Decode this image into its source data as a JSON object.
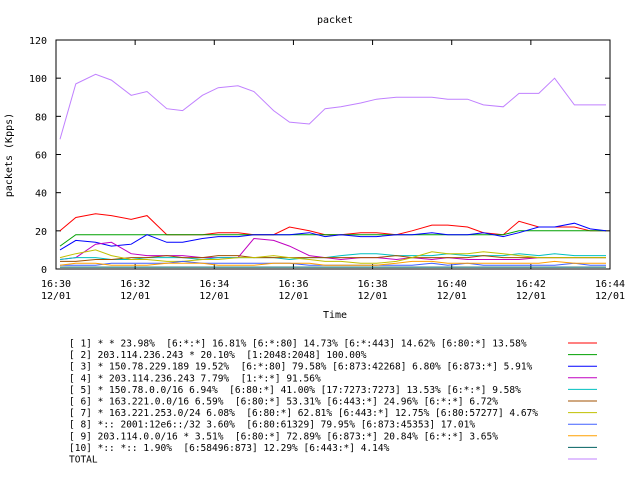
{
  "chart_data": {
    "type": "line",
    "title": "packet",
    "xlabel": "Time",
    "ylabel": "packets (Kpps)",
    "ylim": [
      0,
      120
    ],
    "xlim": [
      0,
      14
    ],
    "y_ticks": [
      0,
      20,
      40,
      60,
      80,
      100,
      120
    ],
    "x_ticks": [
      {
        "t": 0,
        "time": "16:30",
        "date": "12/01"
      },
      {
        "t": 2,
        "time": "16:32",
        "date": "12/01"
      },
      {
        "t": 4,
        "time": "16:34",
        "date": "12/01"
      },
      {
        "t": 6,
        "time": "16:36",
        "date": "12/01"
      },
      {
        "t": 8,
        "time": "16:38",
        "date": "12/01"
      },
      {
        "t": 10,
        "time": "16:40",
        "date": "12/01"
      },
      {
        "t": 12,
        "time": "16:42",
        "date": "12/01"
      },
      {
        "t": 14,
        "time": "16:44",
        "date": "12/01"
      }
    ],
    "grid": false,
    "legend_position": "bottom",
    "x": [
      0.1,
      0.5,
      1.0,
      1.4,
      1.9,
      2.3,
      2.8,
      3.2,
      3.7,
      4.1,
      4.6,
      5.0,
      5.5,
      5.9,
      6.4,
      6.8,
      7.2,
      7.7,
      8.1,
      8.6,
      9.0,
      9.5,
      9.9,
      10.4,
      10.8,
      11.3,
      11.7,
      12.2,
      12.6,
      13.1,
      13.5,
      13.9
    ],
    "series": [
      {
        "name": "[ 1] * * 23.98%  [6:*:*] 16.81% [6:*:80] 14.73% [6:*:443] 14.62% [6:80:*] 13.58%",
        "color": "#ff0000",
        "values": [
          20,
          27,
          29,
          28,
          26,
          28,
          18,
          18,
          18,
          19,
          19,
          18,
          18,
          22,
          20,
          18,
          18,
          19,
          19,
          18,
          20,
          23,
          23,
          22,
          19,
          18,
          25,
          22,
          22,
          22,
          20,
          20
        ]
      },
      {
        "name": "[ 2] 203.114.236.243 * 20.10%  [1:2048:2048] 100.00%",
        "color": "#00a000",
        "values": [
          12,
          18,
          18,
          18,
          18,
          18,
          18,
          18,
          18,
          18,
          18,
          18,
          18,
          18,
          18,
          18,
          18,
          18,
          18,
          18,
          18,
          18,
          18,
          18,
          18,
          18,
          20,
          20,
          20,
          20,
          20,
          20
        ]
      },
      {
        "name": "[ 3] * 150.78.229.189 19.52%  [6:*:80] 79.58% [6:873:42268] 6.80% [6:873:*] 5.91%",
        "color": "#0000ff",
        "values": [
          10,
          15,
          14,
          12,
          13,
          18,
          14,
          14,
          16,
          17,
          17,
          18,
          18,
          18,
          19,
          17,
          18,
          17,
          17,
          18,
          18,
          19,
          18,
          18,
          19,
          17,
          19,
          22,
          22,
          24,
          21,
          20
        ]
      },
      {
        "name": "[ 4] * 203.114.236.243 7.79%  [1:*:*] 91.56%",
        "color": "#c000c0",
        "values": [
          5,
          6,
          13,
          14,
          8,
          7,
          7,
          7,
          6,
          6,
          6,
          16,
          15,
          12,
          7,
          6,
          5,
          6,
          6,
          5,
          6,
          5,
          6,
          5,
          5,
          5,
          5,
          6,
          6,
          6,
          6,
          6
        ]
      },
      {
        "name": "[ 5] * 150.78.0.0/16 6.94%  [6:80:*] 41.00% [17:7273:7273] 13.53% [6:*:*] 9.58%",
        "color": "#00c0c0",
        "values": [
          5,
          6,
          6,
          5,
          5,
          6,
          6,
          6,
          5,
          6,
          6,
          6,
          6,
          5,
          6,
          6,
          7,
          8,
          8,
          7,
          7,
          7,
          8,
          7,
          7,
          7,
          8,
          7,
          8,
          7,
          7,
          7
        ]
      },
      {
        "name": "[ 6] * 163.221.0.0/16 6.59%  [6:80:*] 53.31% [6:443:*] 24.96% [6:*:*] 6.72%",
        "color": "#a05000",
        "values": [
          4,
          4,
          5,
          5,
          6,
          6,
          7,
          6,
          6,
          7,
          7,
          6,
          6,
          6,
          6,
          6,
          6,
          6,
          6,
          7,
          6,
          6,
          6,
          6,
          7,
          6,
          6,
          6,
          6,
          6,
          6,
          6
        ]
      },
      {
        "name": "[ 7] * 163.221.253.0/24 6.08%  [6:80:*] 62.81% [6:443:*] 12.75% [6:80:57277] 4.67%",
        "color": "#c0c000",
        "values": [
          6,
          8,
          10,
          7,
          5,
          5,
          4,
          4,
          5,
          5,
          6,
          6,
          7,
          6,
          5,
          4,
          4,
          3,
          3,
          4,
          6,
          9,
          8,
          8,
          9,
          8,
          7,
          6,
          6,
          6,
          6,
          6
        ]
      },
      {
        "name": "[ 8] *:: 2001:12e6::/32 3.60%  [6:80:61329] 79.95% [6:873:45353] 17.01%",
        "color": "#4060ff",
        "values": [
          2,
          2,
          2,
          3,
          3,
          3,
          3,
          4,
          3,
          3,
          3,
          3,
          3,
          3,
          2,
          2,
          2,
          2,
          2,
          2,
          2,
          3,
          2,
          3,
          2,
          2,
          2,
          2,
          2,
          3,
          2,
          2
        ]
      },
      {
        "name": "[ 9] 203.114.0.0/16 * 3.51%  [6:80:*] 72.89% [6:873:*] 20.84% [6:*:*] 3.65%",
        "color": "#ffa000",
        "values": [
          2,
          3,
          3,
          2,
          2,
          2,
          3,
          3,
          3,
          2,
          2,
          2,
          3,
          3,
          3,
          2,
          2,
          2,
          2,
          3,
          4,
          4,
          3,
          3,
          3,
          3,
          3,
          3,
          4,
          3,
          3,
          3
        ]
      },
      {
        "name": "[10] *:: *:: 1.90%  [6:58496:873] 12.29% [6:443:*] 4.14%",
        "color": "#006060",
        "values": [
          1,
          1,
          1,
          1,
          1,
          1,
          1,
          1,
          1,
          1,
          1,
          1,
          1,
          1,
          1,
          1,
          1,
          1,
          1,
          1,
          1,
          1,
          1,
          1,
          1,
          1,
          1,
          1,
          1,
          1,
          1,
          1
        ]
      },
      {
        "name": "TOTAL",
        "color": "#c080ff",
        "values": [
          68,
          97,
          102,
          99,
          91,
          93,
          84,
          83,
          91,
          95,
          96,
          93,
          83,
          77,
          76,
          84,
          85,
          87,
          89,
          90,
          90,
          90,
          89,
          89,
          86,
          85,
          92,
          92,
          100,
          86,
          86,
          86
        ]
      }
    ]
  }
}
